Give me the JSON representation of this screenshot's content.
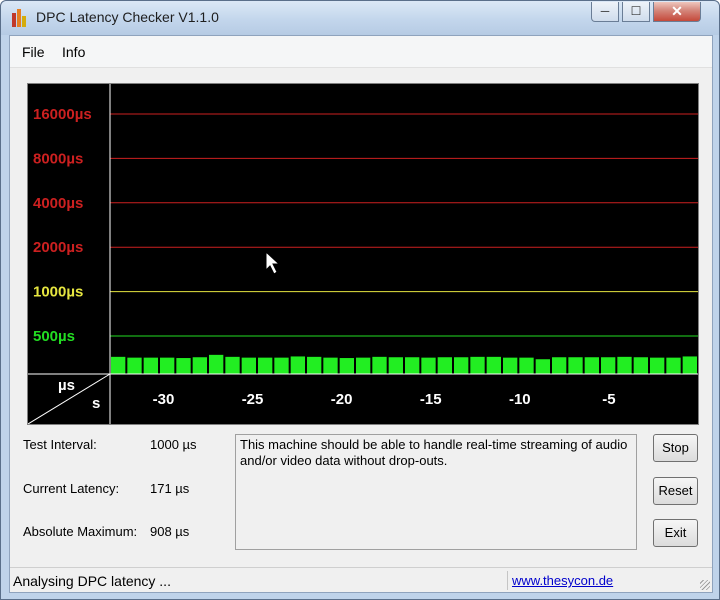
{
  "window": {
    "title": "DPC Latency Checker V1.1.0",
    "controls": {
      "minimize": "─",
      "maximize": "☐",
      "close": "✕"
    }
  },
  "menu": {
    "items": [
      "File",
      "Info"
    ]
  },
  "chart_data": {
    "type": "bar",
    "y_axis_unit": "µs",
    "x_axis_unit": "s",
    "y_scale": "log",
    "levels": [
      {
        "label": "16000µs",
        "value": 16000,
        "color": "#cc2020"
      },
      {
        "label": "8000µs",
        "value": 8000,
        "color": "#cc2020"
      },
      {
        "label": "4000µs",
        "value": 4000,
        "color": "#cc2020"
      },
      {
        "label": "2000µs",
        "value": 2000,
        "color": "#cc2020"
      },
      {
        "label": "1000µs",
        "value": 1000,
        "color": "#e6e640"
      },
      {
        "label": "500µs",
        "value": 500,
        "color": "#22dd22"
      }
    ],
    "x_ticks": [
      -30,
      -25,
      -20,
      -15,
      -10,
      -5
    ],
    "x_range": [
      -33,
      0
    ],
    "bar_color": "#22ee22",
    "values": [
      215,
      205,
      205,
      205,
      200,
      210,
      240,
      215,
      205,
      205,
      205,
      220,
      215,
      205,
      200,
      205,
      215,
      210,
      210,
      205,
      210,
      210,
      215,
      215,
      205,
      205,
      185,
      210,
      210,
      210,
      210,
      215,
      210,
      205,
      205,
      220
    ]
  },
  "stats": {
    "test_interval_label": "Test Interval:",
    "test_interval_value": "1000 µs",
    "current_latency_label": "Current Latency:",
    "current_latency_value": "171 µs",
    "absolute_max_label": "Absolute Maximum:",
    "absolute_max_value": "908 µs"
  },
  "message": "This machine should be able to handle real-time streaming of audio and/or video data without drop-outs.",
  "buttons": {
    "stop": "Stop",
    "reset": "Reset",
    "exit": "Exit"
  },
  "status": {
    "text": "Analysing DPC latency ...",
    "link": "www.thesycon.de"
  }
}
